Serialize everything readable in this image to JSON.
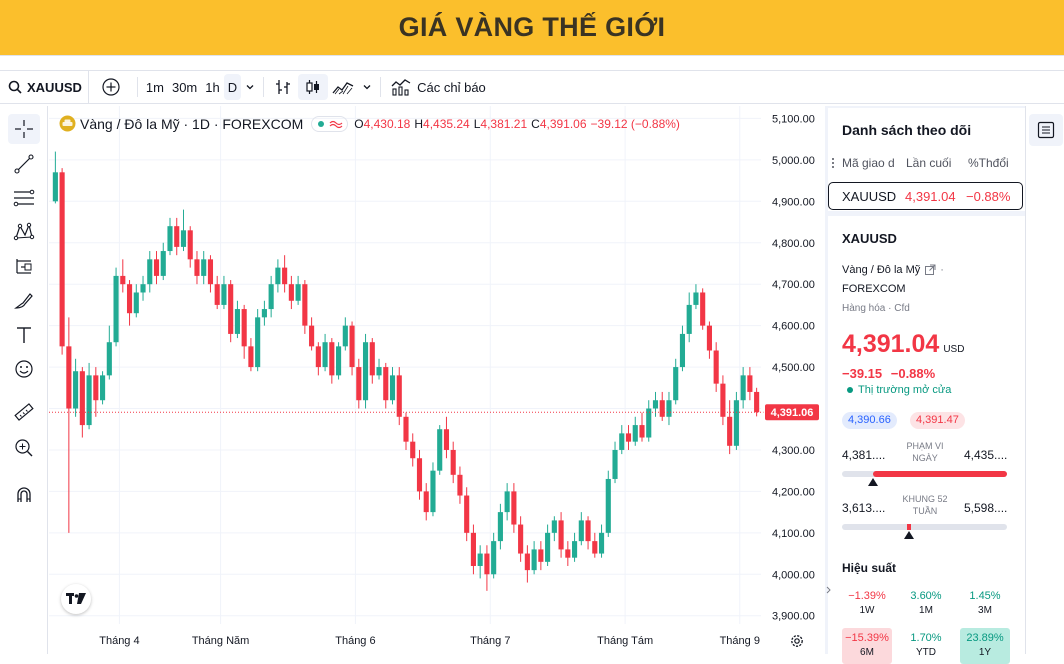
{
  "banner": {
    "title": "GIÁ VÀNG THẾ GIỚI"
  },
  "toolbar": {
    "symbol": "XAUUSD",
    "intervals": [
      "1m",
      "30m",
      "1h",
      "D"
    ],
    "active_interval": "D",
    "indicators_label": "Các chỉ báo"
  },
  "legend": {
    "title": "Vàng / Đô la Mỹ · 1D · FOREXCOM",
    "o_label": "O",
    "o": "4,430.18",
    "h_label": "H",
    "h": "4,435.24",
    "l_label": "L",
    "l": "4,381.21",
    "c_label": "C",
    "c": "4,391.06",
    "change": "−39.12 (−0.88%)"
  },
  "price_scale": {
    "ticks": [
      "5,100.00",
      "5,000.00",
      "4,900.00",
      "4,800.00",
      "4,700.00",
      "4,600.00",
      "4,500.00",
      "4,400.00",
      "4,300.00",
      "4,200.00",
      "4,100.00",
      "4,000.00",
      "3,900.00"
    ],
    "current_label": "4,391.06"
  },
  "time_scale": {
    "labels": [
      "Tháng 4",
      "Tháng Năm",
      "Tháng 6",
      "Tháng 7",
      "Tháng Tám",
      "Tháng 9"
    ]
  },
  "watchlist": {
    "title": "Danh sách theo dõi",
    "columns": [
      "Mã giao d",
      "Lần cuối",
      "%Thđổi"
    ],
    "row": {
      "symbol": "XAUUSD",
      "last": "4,391.04",
      "change_pct": "−0.88%"
    }
  },
  "details": {
    "symbol": "XAUUSD",
    "name": "Vàng / Đô la Mỹ",
    "name_suffix": "·",
    "exchange": "FOREXCOM",
    "category": "Hàng hóa",
    "category_type": "Cfd",
    "price": "4,391.04",
    "currency": "USD",
    "change": "−39.15",
    "change_pct": "−0.88%",
    "market_status": "Thị trường mở cửa",
    "bid": "4,390.66",
    "ask": "4,391.47",
    "day_range": {
      "low": "4,381....",
      "label1": "PHẠM VI",
      "label2": "NGÀY",
      "high": "4,435...."
    },
    "week52_range": {
      "low": "3,613....",
      "label1": "KHUNG 52",
      "label2": "TUẦN",
      "high": "5,598...."
    },
    "performance": {
      "title": "Hiệu suất",
      "items": [
        {
          "value": "−1.39%",
          "period": "1W"
        },
        {
          "value": "3.60%",
          "period": "1M"
        },
        {
          "value": "1.45%",
          "period": "3M"
        },
        {
          "value": "−15.39%",
          "period": "6M"
        },
        {
          "value": "1.70%",
          "period": "YTD"
        },
        {
          "value": "23.89%",
          "period": "1Y"
        }
      ]
    }
  },
  "colors": {
    "up": "#22ab94",
    "down": "#f23645",
    "banner": "#fbbf2c",
    "accent": "#2962ff"
  },
  "chart_data": {
    "type": "candlestick",
    "title": "Vàng / Đô la Mỹ · 1D · FOREXCOM",
    "ylim": [
      3880,
      5130
    ],
    "current_price": 4391.06,
    "x_labels": [
      "Tháng 4",
      "Tháng Năm",
      "Tháng 6",
      "Tháng 7",
      "Tháng Tám",
      "Tháng 9"
    ],
    "candles": [
      [
        4900,
        4970,
        5020,
        4895
      ],
      [
        4970,
        4550,
        4980,
        4530
      ],
      [
        4550,
        4400,
        4620,
        4100
      ],
      [
        4400,
        4490,
        4520,
        4380
      ],
      [
        4490,
        4360,
        4500,
        4330
      ],
      [
        4360,
        4480,
        4510,
        4350
      ],
      [
        4480,
        4420,
        4500,
        4380
      ],
      [
        4420,
        4480,
        4490,
        4410
      ],
      [
        4480,
        4560,
        4600,
        4470
      ],
      [
        4560,
        4720,
        4740,
        4550
      ],
      [
        4720,
        4700,
        4760,
        4680
      ],
      [
        4700,
        4630,
        4710,
        4600
      ],
      [
        4630,
        4680,
        4700,
        4620
      ],
      [
        4680,
        4700,
        4720,
        4660
      ],
      [
        4700,
        4760,
        4780,
        4680
      ],
      [
        4760,
        4720,
        4780,
        4700
      ],
      [
        4720,
        4780,
        4800,
        4710
      ],
      [
        4780,
        4840,
        4860,
        4770
      ],
      [
        4840,
        4790,
        4860,
        4770
      ],
      [
        4790,
        4830,
        4880,
        4780
      ],
      [
        4830,
        4760,
        4840,
        4740
      ],
      [
        4760,
        4720,
        4780,
        4700
      ],
      [
        4720,
        4760,
        4780,
        4700
      ],
      [
        4760,
        4700,
        4770,
        4680
      ],
      [
        4700,
        4650,
        4720,
        4640
      ],
      [
        4650,
        4700,
        4720,
        4640
      ],
      [
        4700,
        4580,
        4710,
        4560
      ],
      [
        4580,
        4640,
        4660,
        4570
      ],
      [
        4640,
        4550,
        4650,
        4520
      ],
      [
        4550,
        4500,
        4570,
        4490
      ],
      [
        4500,
        4620,
        4640,
        4490
      ],
      [
        4620,
        4640,
        4660,
        4600
      ],
      [
        4640,
        4700,
        4720,
        4620
      ],
      [
        4700,
        4740,
        4760,
        4680
      ],
      [
        4740,
        4700,
        4770,
        4680
      ],
      [
        4700,
        4660,
        4720,
        4640
      ],
      [
        4660,
        4700,
        4720,
        4650
      ],
      [
        4700,
        4600,
        4710,
        4580
      ],
      [
        4600,
        4550,
        4620,
        4540
      ],
      [
        4550,
        4500,
        4560,
        4480
      ],
      [
        4500,
        4560,
        4580,
        4490
      ],
      [
        4560,
        4480,
        4570,
        4460
      ],
      [
        4480,
        4550,
        4560,
        4470
      ],
      [
        4550,
        4600,
        4620,
        4540
      ],
      [
        4600,
        4500,
        4610,
        4480
      ],
      [
        4500,
        4420,
        4520,
        4400
      ],
      [
        4420,
        4560,
        4580,
        4400
      ],
      [
        4560,
        4480,
        4570,
        4460
      ],
      [
        4480,
        4500,
        4520,
        4470
      ],
      [
        4500,
        4420,
        4510,
        4400
      ],
      [
        4420,
        4480,
        4500,
        4410
      ],
      [
        4480,
        4380,
        4500,
        4360
      ],
      [
        4380,
        4320,
        4390,
        4300
      ],
      [
        4320,
        4280,
        4340,
        4260
      ],
      [
        4280,
        4200,
        4300,
        4180
      ],
      [
        4200,
        4150,
        4220,
        4130
      ],
      [
        4150,
        4250,
        4270,
        4140
      ],
      [
        4250,
        4350,
        4360,
        4240
      ],
      [
        4350,
        4300,
        4380,
        4280
      ],
      [
        4300,
        4240,
        4320,
        4220
      ],
      [
        4240,
        4190,
        4260,
        4170
      ],
      [
        4190,
        4100,
        4210,
        4080
      ],
      [
        4100,
        4020,
        4120,
        4000
      ],
      [
        4020,
        4050,
        4070,
        3990
      ],
      [
        4050,
        4000,
        4070,
        3960
      ],
      [
        4000,
        4080,
        4100,
        3990
      ],
      [
        4080,
        4150,
        4170,
        4060
      ],
      [
        4150,
        4200,
        4220,
        4130
      ],
      [
        4200,
        4120,
        4220,
        4100
      ],
      [
        4120,
        4050,
        4140,
        4030
      ],
      [
        4050,
        4010,
        4070,
        3980
      ],
      [
        4010,
        4060,
        4080,
        4000
      ],
      [
        4060,
        4030,
        4080,
        4010
      ],
      [
        4030,
        4100,
        4120,
        4020
      ],
      [
        4100,
        4130,
        4140,
        4080
      ],
      [
        4130,
        4060,
        4150,
        4040
      ],
      [
        4060,
        4040,
        4080,
        4020
      ],
      [
        4040,
        4080,
        4100,
        4030
      ],
      [
        4080,
        4130,
        4150,
        4070
      ],
      [
        4130,
        4080,
        4140,
        4060
      ],
      [
        4080,
        4050,
        4100,
        4040
      ],
      [
        4050,
        4100,
        4120,
        4040
      ],
      [
        4100,
        4230,
        4250,
        4090
      ],
      [
        4230,
        4300,
        4320,
        4220
      ],
      [
        4300,
        4340,
        4360,
        4290
      ],
      [
        4340,
        4320,
        4360,
        4300
      ],
      [
        4320,
        4360,
        4380,
        4310
      ],
      [
        4360,
        4330,
        4390,
        4320
      ],
      [
        4330,
        4400,
        4420,
        4320
      ],
      [
        4400,
        4420,
        4440,
        4380
      ],
      [
        4420,
        4380,
        4440,
        4370
      ],
      [
        4380,
        4420,
        4440,
        4360
      ],
      [
        4420,
        4500,
        4520,
        4410
      ],
      [
        4500,
        4580,
        4600,
        4490
      ],
      [
        4580,
        4650,
        4680,
        4560
      ],
      [
        4650,
        4680,
        4700,
        4640
      ],
      [
        4680,
        4600,
        4690,
        4590
      ],
      [
        4600,
        4540,
        4610,
        4520
      ],
      [
        4540,
        4460,
        4560,
        4440
      ],
      [
        4460,
        4380,
        4480,
        4360
      ],
      [
        4380,
        4310,
        4420,
        4290
      ],
      [
        4310,
        4420,
        4440,
        4300
      ],
      [
        4420,
        4480,
        4500,
        4400
      ],
      [
        4480,
        4440,
        4500,
        4420
      ],
      [
        4440,
        4391.06,
        4450,
        4381
      ]
    ]
  }
}
